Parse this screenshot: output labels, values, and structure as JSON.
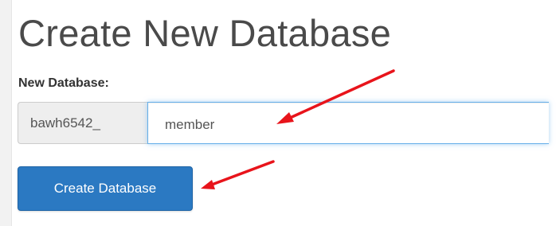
{
  "form": {
    "title": "Create New Database",
    "field_label": "New Database:",
    "prefix": "bawh6542_",
    "input_value": "member",
    "submit_label": "Create Database"
  },
  "annotations": {
    "arrow_color": "#e8141b"
  },
  "theme": {
    "button_color": "#2b79c2",
    "input_focus_color": "#66afe9"
  }
}
